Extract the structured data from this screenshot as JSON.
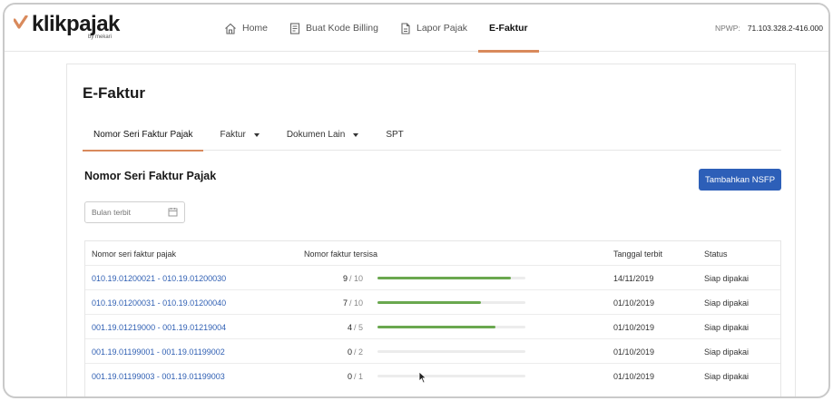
{
  "brand": {
    "name": "klikpajak",
    "sub": "by mekari",
    "accent": "#d98a5c"
  },
  "nav": {
    "items": [
      {
        "label": "Home",
        "icon": "home-icon"
      },
      {
        "label": "Buat Kode Billing",
        "icon": "billing-icon"
      },
      {
        "label": "Lapor Pajak",
        "icon": "document-icon"
      },
      {
        "label": "E-Faktur",
        "icon": ""
      }
    ],
    "active": "E-Faktur"
  },
  "npwp": {
    "label": "NPWP:",
    "value": "71.103.328.2-416.000"
  },
  "page": {
    "title": "E-Faktur"
  },
  "subtabs": [
    {
      "label": "Nomor Seri Faktur Pajak",
      "dropdown": false
    },
    {
      "label": "Faktur",
      "dropdown": true
    },
    {
      "label": "Dokumen Lain",
      "dropdown": true
    },
    {
      "label": "SPT",
      "dropdown": false
    }
  ],
  "section": {
    "title": "Nomor Seri Faktur Pajak",
    "add_button": "Tambahkan NSFP",
    "filter_placeholder": "Bulan terbit"
  },
  "table": {
    "headers": [
      "Nomor seri faktur pajak",
      "Nomor faktur tersisa",
      "Tanggal terbit",
      "Status"
    ],
    "rows": [
      {
        "range": "010.19.01200021 - 010.19.01200030",
        "remaining": "9",
        "total": "/ 10",
        "fraction": 0.9,
        "date": "14/11/2019",
        "status": "Siap dipakai"
      },
      {
        "range": "010.19.01200031 - 010.19.01200040",
        "remaining": "7",
        "total": "/ 10",
        "fraction": 0.7,
        "date": "01/10/2019",
        "status": "Siap dipakai"
      },
      {
        "range": "001.19.01219000 - 001.19.01219004",
        "remaining": "4",
        "total": "/ 5",
        "fraction": 0.8,
        "date": "01/10/2019",
        "status": "Siap dipakai"
      },
      {
        "range": "001.19.01199001 - 001.19.01199002",
        "remaining": "0",
        "total": "/ 2",
        "fraction": 0,
        "date": "01/10/2019",
        "status": "Siap dipakai"
      },
      {
        "range": "001.19.01199003 - 001.19.01199003",
        "remaining": "0",
        "total": "/ 1",
        "fraction": 0,
        "date": "01/10/2019",
        "status": "Siap dipakai"
      }
    ]
  },
  "colors": {
    "link": "#2f5fb3",
    "button": "#2d5fb8",
    "progress": "#6aa84f"
  }
}
